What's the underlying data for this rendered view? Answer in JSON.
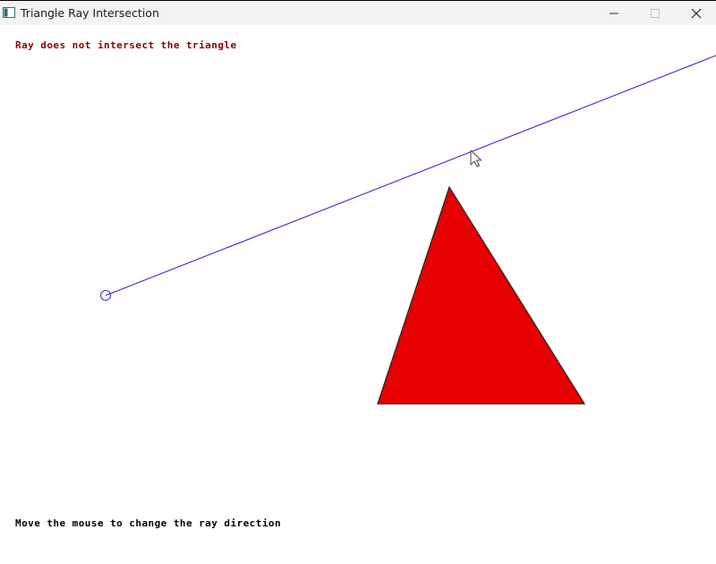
{
  "window": {
    "title": "Triangle Ray Intersection"
  },
  "status_message": "Ray does not intersect the triangle",
  "hint_message": "Move the mouse to change the ray direction",
  "colors": {
    "triangle_fill": "#e60000",
    "triangle_stroke": "#222222",
    "ray": "#3b3bdc",
    "status_text": "#8b0000",
    "hint_text": "#000000"
  },
  "icons": {
    "app": "app-icon",
    "minimize": "minimize-icon",
    "maximize": "maximize-icon",
    "close": "close-icon",
    "cursor": "mouse-cursor-icon"
  }
}
